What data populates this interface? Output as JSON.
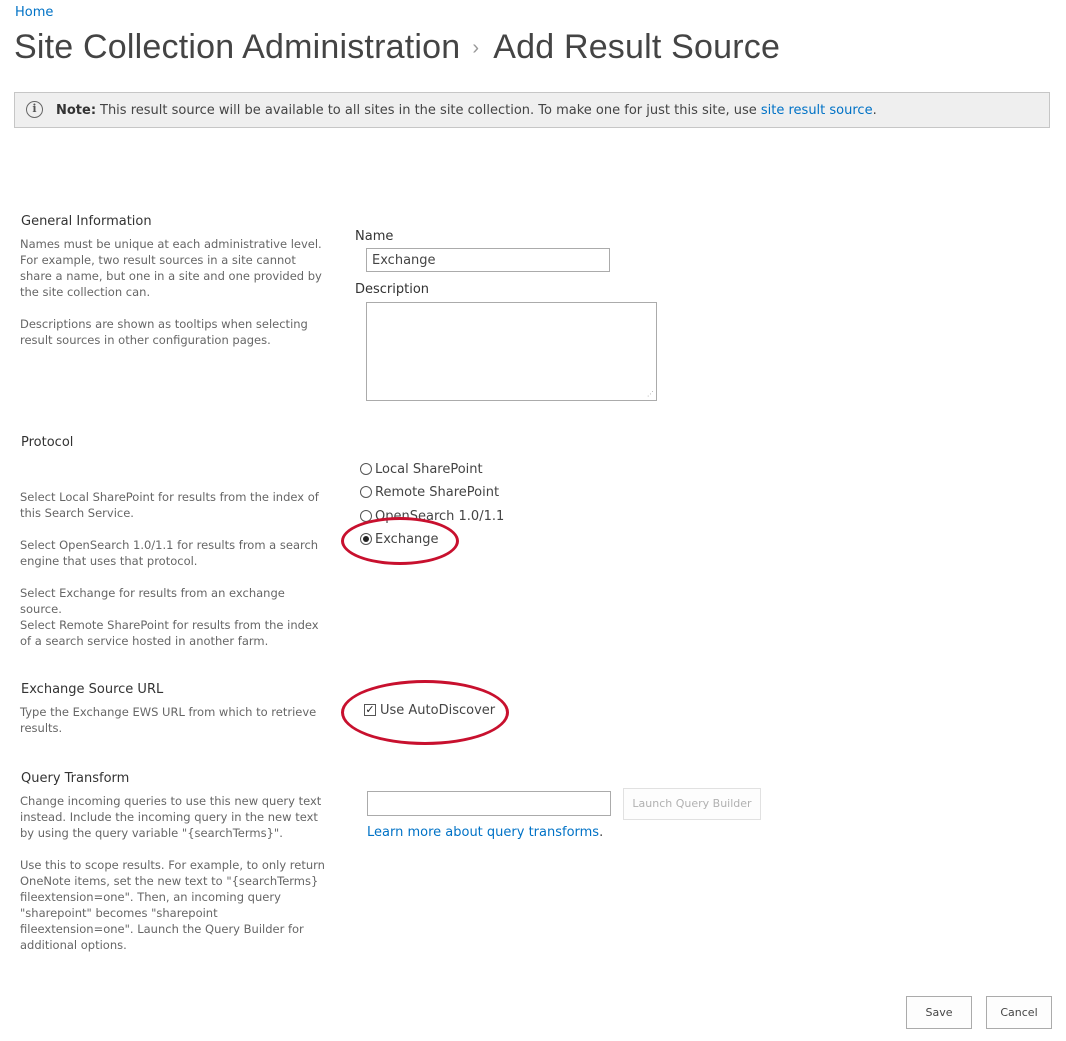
{
  "breadcrumb": {
    "home": "Home"
  },
  "title": {
    "part1": "Site Collection Administration",
    "separator": "›",
    "part2": "Add Result Source"
  },
  "note": {
    "label": "Note:",
    "text": "This result source will be available to all sites in the site collection. To make one for just this site, use ",
    "link": "site result source",
    "end": "."
  },
  "general": {
    "title": "General Information",
    "desc1": "Names must be unique at each administrative level. For example, two result sources in a site cannot share a name, but one in a site and one provided by the site collection can.",
    "desc2": "Descriptions are shown as tooltips when selecting result sources in other configuration pages.",
    "name_label": "Name",
    "name_value": "Exchange",
    "description_label": "Description",
    "description_value": ""
  },
  "protocol": {
    "title": "Protocol",
    "desc1": "Select Local SharePoint for results from the index of this Search Service.",
    "desc2": "Select OpenSearch 1.0/1.1 for results from a search engine that uses that protocol.",
    "desc3": "Select Exchange for results from an exchange source.",
    "desc4": "Select Remote SharePoint for results from the index of a search service hosted in another farm.",
    "options": [
      "Local SharePoint",
      "Remote SharePoint",
      "OpenSearch 1.0/1.1",
      "Exchange"
    ],
    "selected": "Exchange"
  },
  "exchange_url": {
    "title": "Exchange Source URL",
    "desc": "Type the Exchange EWS URL from which to retrieve results.",
    "autodiscover_label": "Use AutoDiscover",
    "autodiscover_checked": true
  },
  "query_transform": {
    "title": "Query Transform",
    "desc1": "Change incoming queries to use this new query text instead. Include the incoming query in the new text by using the query variable \"{searchTerms}\".",
    "desc2": "Use this to scope results. For example, to only return OneNote items, set the new text to \"{searchTerms} fileextension=one\". Then, an incoming query \"sharepoint\" becomes \"sharepoint fileextension=one\". Launch the Query Builder for additional options.",
    "value": "",
    "launch_button": "Launch Query Builder",
    "learn_more": "Learn more about query transforms",
    "learn_more_end": "."
  },
  "actions": {
    "save": "Save",
    "cancel": "Cancel"
  },
  "colors": {
    "link": "#0072c6",
    "annotation": "#c8102e",
    "note_bg": "#efefef"
  }
}
